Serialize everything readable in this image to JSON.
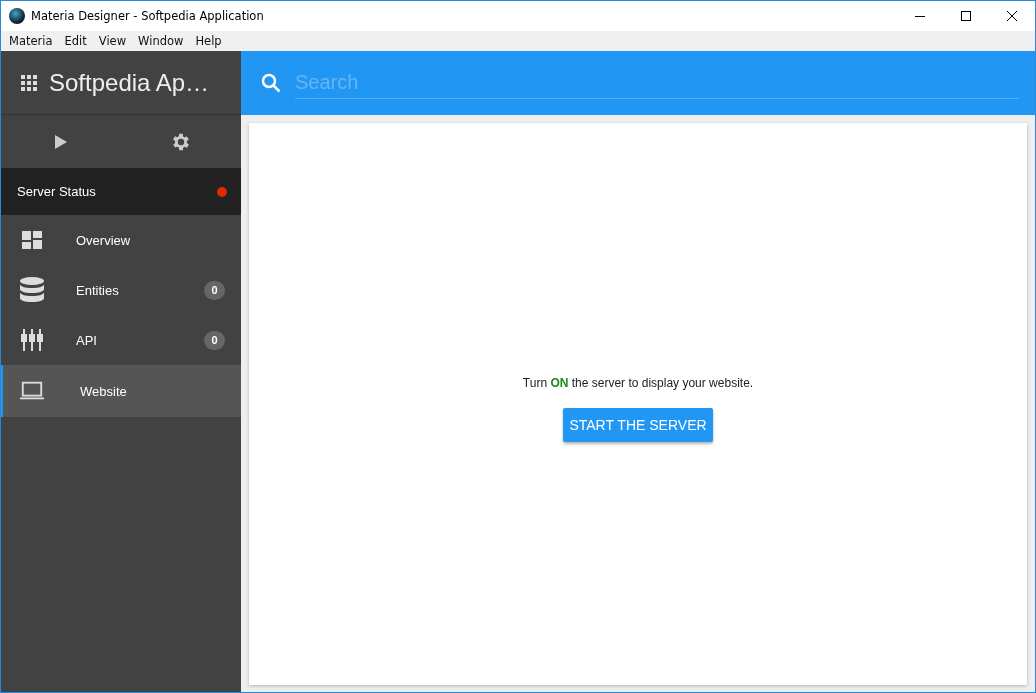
{
  "window": {
    "title": "Materia Designer - Softpedia Application"
  },
  "menu": [
    "Materia",
    "Edit",
    "View",
    "Window",
    "Help"
  ],
  "sidebar": {
    "title": "Softpedia Ap…",
    "server_status": {
      "label": "Server Status",
      "running": false
    },
    "items": [
      {
        "kind": "overview",
        "label": "Overview",
        "selected": false
      },
      {
        "kind": "entities",
        "label": "Entities",
        "badge": "0",
        "selected": false
      },
      {
        "kind": "api",
        "label": "API",
        "badge": "0",
        "selected": false
      },
      {
        "kind": "website",
        "label": "Website",
        "selected": true
      }
    ]
  },
  "search": {
    "placeholder": "Search"
  },
  "content": {
    "message": "Turn **ON** the server to display your website.",
    "button": "START THE SERVER"
  }
}
